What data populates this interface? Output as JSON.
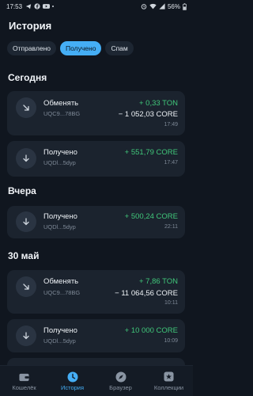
{
  "status": {
    "time": "17:53",
    "battery": "56%"
  },
  "title": "История",
  "tabs": [
    {
      "label": "Отправлено"
    },
    {
      "label": "Получено"
    },
    {
      "label": "Спам"
    }
  ],
  "sections": [
    {
      "title": "Сегодня",
      "rows": [
        {
          "name": "Обменять",
          "address": "UQC9...78BG",
          "amount1": "+ 0,33 TON",
          "amount2": "− 1 052,03 CORE",
          "time": "17:49"
        },
        {
          "name": "Получено",
          "address": "UQDl...5dyp",
          "amount1": "+ 551,79 CORE",
          "time": "17:47"
        }
      ]
    },
    {
      "title": "Вчера",
      "rows": [
        {
          "name": "Получено",
          "address": "UQDl...5dyp",
          "amount1": "+ 500,24 CORE",
          "time": "22:11"
        }
      ]
    },
    {
      "title": "30 май",
      "rows": [
        {
          "name": "Обменять",
          "address": "UQC9...78BG",
          "amount1": "+ 7,86 TON",
          "amount2": "− 11 064,56 CORE",
          "time": "10:11"
        },
        {
          "name": "Получено",
          "address": "UQDl...5dyp",
          "amount1": "+ 10 000 CORE",
          "time": "10:09"
        }
      ]
    }
  ],
  "nav": [
    {
      "label": "Кошелёк",
      "icon": "wallet-icon"
    },
    {
      "label": "История",
      "icon": "history-icon"
    },
    {
      "label": "Браузер",
      "icon": "compass-icon"
    },
    {
      "label": "Коллекции",
      "icon": "collections-icon"
    }
  ],
  "colors": {
    "accent": "#45aef5",
    "positive": "#40c77a",
    "background": "#10161f",
    "card": "#1b232e"
  }
}
